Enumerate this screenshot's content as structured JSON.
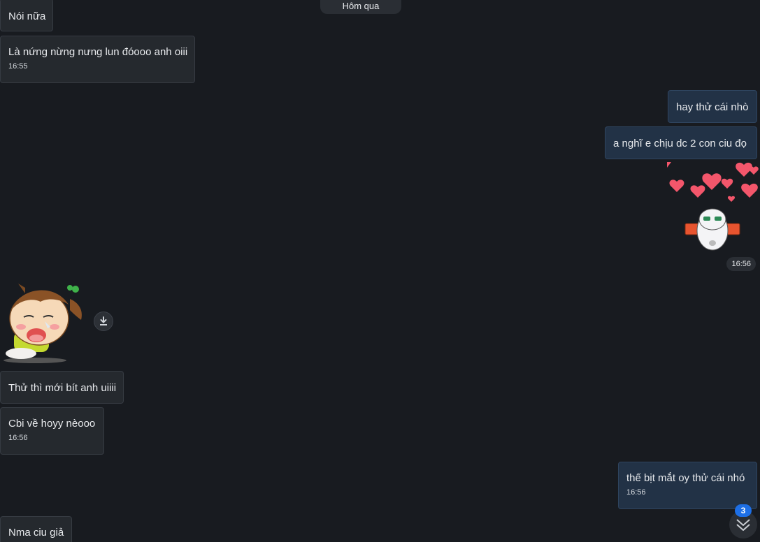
{
  "date_divider": "Hôm qua",
  "messages": [
    {
      "text": "Nói nữa"
    },
    {
      "text": "Là nứng nừng nưng lun đóooo anh oiii",
      "time": "16:55"
    },
    {
      "text": "hay thử cái nhò"
    },
    {
      "text": "a nghĩ e chịu dc 2 con ciu đọ"
    },
    {
      "text": "Thử thì mới bít anh uiiii"
    },
    {
      "text": "Cbi về hoyy nèooo",
      "time": "16:56"
    },
    {
      "text": "thế bịt mắt oy thử cái nhó",
      "time": "16:56"
    },
    {
      "text": "Nma ciu giả"
    }
  ],
  "sticker_out": {
    "icon": "hearts-cat-sticker",
    "time": "16:56"
  },
  "sticker_in": {
    "icon": "crying-girl-sticker"
  },
  "download": {
    "icon": "download-icon"
  },
  "scroll": {
    "icon": "double-chevron-down-icon",
    "unread_count": "3"
  },
  "colors": {
    "background": "#181b20",
    "incoming": "#25292e",
    "outgoing": "#223246",
    "badge": "#1d6fe6"
  }
}
